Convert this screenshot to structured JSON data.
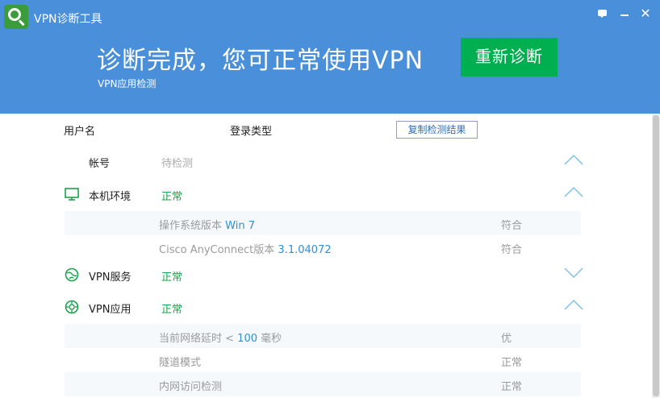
{
  "window": {
    "title": "VPN诊断工具",
    "logo_icon": "magnifier-icon",
    "buttons": [
      "feedback-icon",
      "minimize-icon",
      "close-icon"
    ],
    "close_glyph": "✕"
  },
  "banner": {
    "headline": "诊断完成，您可正常使用VPN",
    "subline": "VPN应用检测",
    "rediagnose_label": "重新诊断"
  },
  "columns": {
    "username_label": "用户名",
    "login_type_label": "登录类型",
    "copy_button_label": "复制检测结果"
  },
  "sections": [
    {
      "label": "帐号",
      "status": "待检测",
      "status_kind": "pending",
      "chevron": "up",
      "icon": "none"
    },
    {
      "label": "本机环境",
      "status": "正常",
      "status_kind": "ok",
      "chevron": "up",
      "icon": "monitor-icon",
      "details": [
        {
          "label": "操作系统版本",
          "value": "Win 7",
          "result": "符合"
        },
        {
          "label": "Cisco AnyConnect版本",
          "value": "3.1.04072",
          "result": "符合"
        }
      ]
    },
    {
      "label": "VPN服务",
      "status": "正常",
      "status_kind": "ok",
      "chevron": "down",
      "icon": "globe-icon"
    },
    {
      "label": "VPN应用",
      "status": "正常",
      "status_kind": "ok",
      "chevron": "up",
      "icon": "target-icon",
      "details": [
        {
          "label": "当前网络延时 <",
          "value": "100",
          "suffix": "毫秒",
          "result": "优"
        },
        {
          "label": "隧道模式",
          "result": "正常"
        },
        {
          "label": "内网访问检测",
          "result": "正常"
        }
      ]
    }
  ],
  "colors": {
    "header_bg": "#4a8fd9",
    "primary_button": "#00b050",
    "status_ok": "#1aa34a",
    "highlight_value": "#2d8fd6",
    "chevron": "#7ec3e6"
  }
}
